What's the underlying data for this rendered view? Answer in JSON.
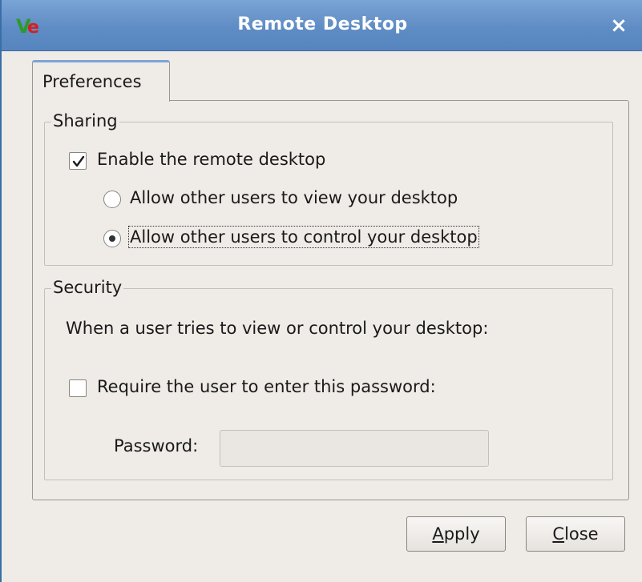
{
  "window": {
    "title": "Remote Desktop",
    "close_glyph": "×",
    "app_icon": "vino-icon",
    "titlebar_color": "#5f8cc4"
  },
  "tabs": [
    {
      "label": "Preferences",
      "active": true
    }
  ],
  "sharing": {
    "legend": "Sharing",
    "enable_label": "Enable the remote desktop",
    "enable_checked": true,
    "view_option_label": "Allow other users to view your desktop",
    "view_option_selected": false,
    "control_option_label": "Allow other users to control your desktop",
    "control_option_selected": true
  },
  "security": {
    "legend": "Security",
    "description": "When a user tries to view or control your desktop:",
    "require_password_label": "Require the user to enter this password:",
    "require_password_checked": false,
    "password_label": "Password:",
    "password_value": ""
  },
  "buttons": {
    "apply": {
      "mnemonic": "A",
      "rest": "pply"
    },
    "close": {
      "mnemonic": "C",
      "rest": "lose"
    }
  }
}
